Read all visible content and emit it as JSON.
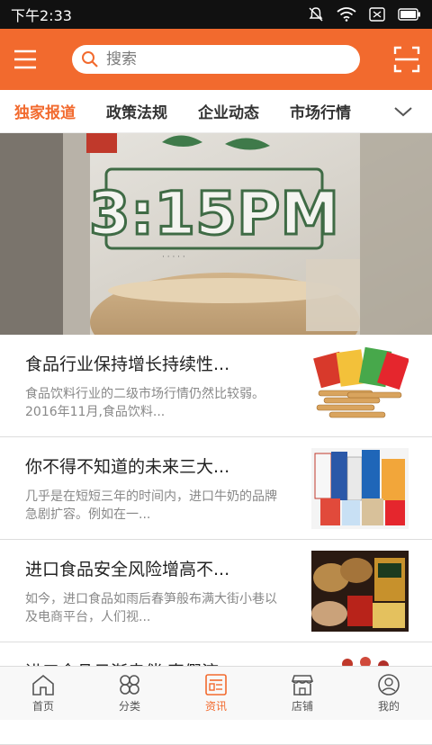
{
  "status_bar": {
    "time": "下午2:33"
  },
  "header": {
    "search_placeholder": "搜索",
    "accent_color": "#f26a2e",
    "icons": [
      "menu-icon",
      "search-icon",
      "scan-icon"
    ]
  },
  "tabs": [
    {
      "label": "独家报道",
      "active": true
    },
    {
      "label": "政策法规",
      "active": false
    },
    {
      "label": "企业动态",
      "active": false
    },
    {
      "label": "市场行情",
      "active": false
    }
  ],
  "banner": {
    "brand_text": "3:15PM",
    "slide_count": 4,
    "active_slide": 4
  },
  "news": [
    {
      "title": "食品行业保持增长持续性...",
      "desc": "食品饮料行业的二级市场行情仍然比较弱。2016年11月,食品饮料..."
    },
    {
      "title": "你不得不知道的未来三大...",
      "desc": "几乎是在短短三年的时间内，进口牛奶的品牌急剧扩容。例如在一..."
    },
    {
      "title": "进口食品安全风险增高不...",
      "desc": "如今，进口食品如雨后春笋般布满大街小巷以及电商平台，人们视..."
    },
    {
      "title": "进口食品日渐走俏 真假济...",
      "desc": ""
    }
  ],
  "bottom_nav": [
    {
      "label": "首页",
      "icon": "home-icon",
      "active": false
    },
    {
      "label": "分类",
      "icon": "category-icon",
      "active": false
    },
    {
      "label": "资讯",
      "icon": "news-icon",
      "active": true
    },
    {
      "label": "店铺",
      "icon": "shop-icon",
      "active": false
    },
    {
      "label": "我的",
      "icon": "profile-icon",
      "active": false
    }
  ]
}
